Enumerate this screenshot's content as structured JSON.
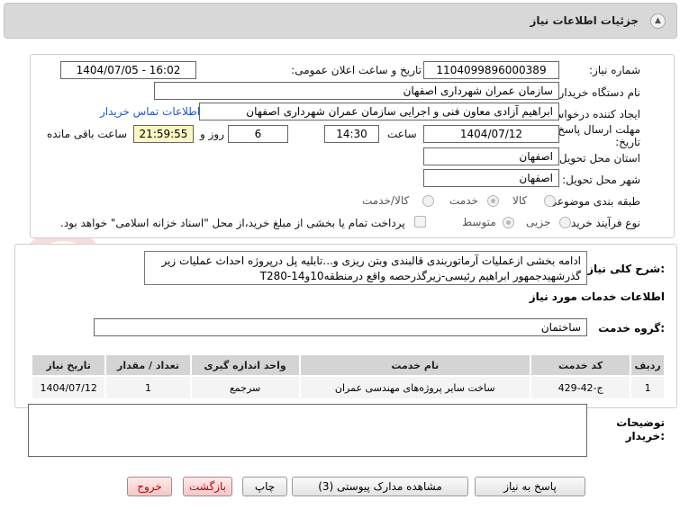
{
  "header": {
    "title": "جزئیات اطلاعات نیاز"
  },
  "form": {
    "need_number": {
      "label": "شماره نیاز:",
      "value": "1104099896000389"
    },
    "announce_datetime": {
      "label": "تاریخ و ساعت اعلان عمومی:",
      "value": "1404/07/05 - 16:02"
    },
    "buyer_org": {
      "label": "نام دستگاه خریدار:",
      "value": "سازمان عمران شهرداری اصفهان"
    },
    "requester": {
      "label": "ایجاد کننده درخواست:",
      "value": "ابراهیم آزادی معاون فنی و اجرایی سازمان عمران شهرداری اصفهان",
      "contact_link": "اطلاعات تماس خریدار"
    },
    "deadline": {
      "label_line1": "مهلت ارسال پاسخ: تا",
      "label_line2": "تاریخ:",
      "date": "1404/07/12",
      "time_label": "ساعت",
      "time": "14:30",
      "days": "6",
      "days_label": "روز و",
      "remaining": "21:59:55",
      "remaining_label": "ساعت باقی مانده"
    },
    "province": {
      "label": "استان محل تحویل:",
      "value": "اصفهان"
    },
    "city": {
      "label": "شهر محل تحویل:",
      "value": "اصفهان"
    },
    "category": {
      "label": "طبقه بندی موضوعی:",
      "options": [
        "کالا",
        "خدمت",
        "کالا/خدمت"
      ],
      "selected": "خدمت"
    },
    "process": {
      "label": "نوع فرآیند خرید :",
      "options": [
        "جزیی",
        "متوسط"
      ],
      "selected": "متوسط",
      "note": "پرداخت تمام یا بخشی از مبلغ خرید،از محل \"اسناد خزانه اسلامی\" خواهد بود."
    }
  },
  "summary": {
    "label": "شرح کلی نیاز:",
    "text": "ادامه بخشی ازعملیات آرماتوربندی قالبندی وبتن ریزی و...تابلیه پل درپروژه احداث عملیات زیر گذرشهیدجمهور ابراهیم رئیسی-زیرگذرحصه واقع درمنطقه10و14-T280"
  },
  "services": {
    "title": "اطلاعات خدمات مورد نیاز",
    "group_label": "گروه خدمت:",
    "group_value": "ساختمان",
    "columns": [
      "ردیف",
      "کد خدمت",
      "نام خدمت",
      "واحد اندازه گیری",
      "تعداد / مقدار",
      "تاریخ نیاز"
    ],
    "rows": [
      [
        "1",
        "ج-42-429",
        "ساخت سایر پروژه‌های مهندسی عمران",
        "سرجمع",
        "1",
        "1404/07/12"
      ]
    ]
  },
  "buyer_notes": {
    "label_line1": "توضیحات",
    "label_line2": "خریدار:",
    "value": ""
  },
  "buttons": {
    "reply": "پاسخ به نیاز",
    "attachments": "مشاهده مدارک پیوستی (3)",
    "print": "چاپ",
    "back": "بازگشت",
    "exit": "خروج"
  },
  "watermark": "AriaTender.net"
}
